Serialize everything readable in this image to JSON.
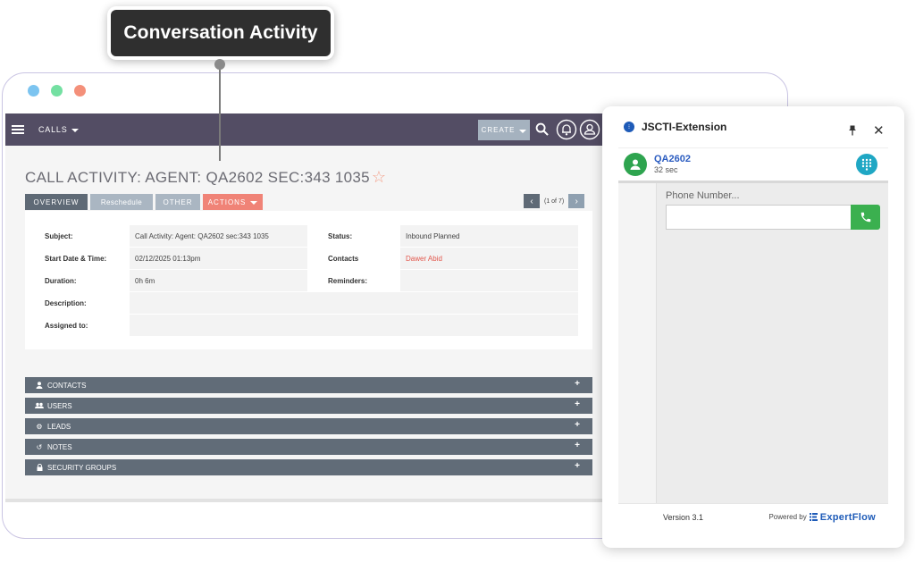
{
  "callout": {
    "label": "Conversation Activity"
  },
  "window": {
    "dot_colors": [
      "#7cc4f0",
      "#74e0a2",
      "#f4907a"
    ]
  },
  "topbar": {
    "module": "CALLS",
    "create_label": "CREATE"
  },
  "record": {
    "title": "CALL ACTIVITY: AGENT: QA2602 SEC:343 1035",
    "tabs": [
      "OVERVIEW",
      "Reschedule",
      "OTHER",
      "ACTIONS"
    ],
    "pager": "(1 of 7)"
  },
  "fields": {
    "subject_label": "Subject:",
    "subject_value": "Call Activity: Agent: QA2602 sec:343 1035",
    "start_label": "Start Date & Time:",
    "start_value": "02/12/2025 01:13pm",
    "duration_label": "Duration:",
    "duration_value": "0h 6m",
    "description_label": "Description:",
    "assigned_label": "Assigned to:",
    "status_label": "Status:",
    "status_value": "Inbound Planned",
    "contacts_label": "Contacts",
    "contacts_value": "Dawer Abid",
    "reminders_label": "Reminders:"
  },
  "subpanels": [
    {
      "label": "CONTACTS",
      "icon": "person-icon"
    },
    {
      "label": "USERS",
      "icon": "users-icon"
    },
    {
      "label": "LEADS",
      "icon": "gear-icon"
    },
    {
      "label": "NOTES",
      "icon": "history-icon"
    },
    {
      "label": "SECURITY GROUPS",
      "icon": "lock-icon"
    }
  ],
  "extension": {
    "title": "JSCTI-Extension",
    "agent_name": "QA2602",
    "agent_time": "32 sec",
    "phone_label": "Phone Number...",
    "phone_value": "",
    "version": "Version 3.1",
    "powered_by": "Powered by",
    "brand": "ExpertFlow"
  }
}
